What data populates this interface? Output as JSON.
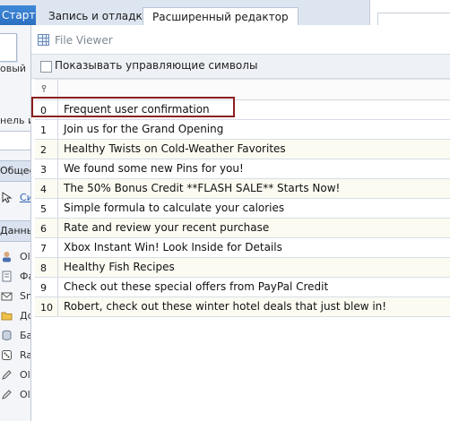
{
  "tabs": {
    "start": "Старт",
    "record": "Запись и отладка",
    "advanced": "Расширенный редактор"
  },
  "left_panel": {
    "big_button_label": "овый",
    "panel_label": "нель и",
    "header_general": "Общее",
    "link_text": "Си",
    "header_data": "Данные",
    "items": [
      {
        "icon": "user-icon",
        "label": "Ol"
      },
      {
        "icon": "file-icon",
        "label": "Фа"
      },
      {
        "icon": "mail-icon",
        "label": "Sn"
      },
      {
        "icon": "folder-icon",
        "label": "Дс"
      },
      {
        "icon": "database-icon",
        "label": "Ба"
      },
      {
        "icon": "dice-icon",
        "label": "Ra"
      },
      {
        "icon": "pen-icon",
        "label": "Ol"
      },
      {
        "icon": "pen-icon",
        "label": "Ol"
      }
    ]
  },
  "viewer": {
    "title": "File Viewer",
    "show_control_chars": "Показывать управляющие символы",
    "rows": [
      {
        "index": "0",
        "text": "Frequent user confirmation"
      },
      {
        "index": "1",
        "text": "Join us for the Grand Opening"
      },
      {
        "index": "2",
        "text": "Healthy Twists on Cold-Weather Favorites"
      },
      {
        "index": "3",
        "text": "We found some new Pins for you!"
      },
      {
        "index": "4",
        "text": "The 50% Bonus Credit **FLASH SALE** Starts Now!"
      },
      {
        "index": "5",
        "text": "Simple formula to calculate your calories"
      },
      {
        "index": "6",
        "text": "Rate and review your recent purchase"
      },
      {
        "index": "7",
        "text": "Xbox Instant Win! Look Inside for Details"
      },
      {
        "index": "8",
        "text": "Healthy Fish Recipes"
      },
      {
        "index": "9",
        "text": "Check out these special offers from PayPal Credit"
      },
      {
        "index": "10",
        "text": "Robert, check out these winter hotel deals that just blew in!"
      }
    ]
  },
  "colors": {
    "selection_border": "#8b1f1f",
    "start_tab": "#2b6fc0"
  }
}
